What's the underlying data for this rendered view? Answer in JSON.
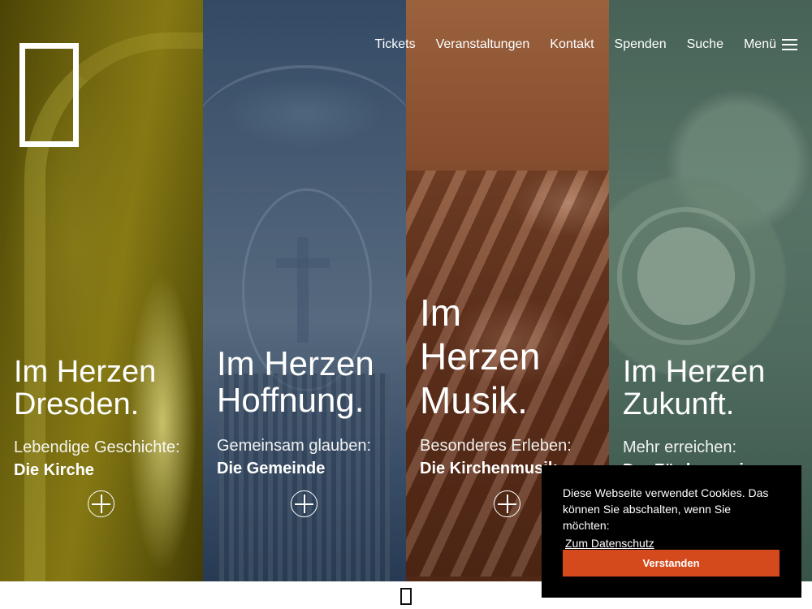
{
  "nav": {
    "items": [
      "Tickets",
      "Veranstaltungen",
      "Kontakt",
      "Spenden",
      "Suche"
    ],
    "menu_label": "Menü"
  },
  "panels": [
    {
      "headline": "Im Herzen Dresden.",
      "subtitle": "Lebendige Geschichte:",
      "link": "Die Kirche",
      "tint": "#8c801c"
    },
    {
      "headline": "Im Herzen Hoffnung.",
      "subtitle": "Gemeinsam glauben:",
      "link": "Die Gemeinde",
      "tint": "#58687a"
    },
    {
      "headline": "Im Herzen Musik.",
      "subtitle": "Besonderes Erleben:",
      "link": "Die Kirchenmusik",
      "tint": "#7c4e35"
    },
    {
      "headline": "Im Herzen Zukunft.",
      "subtitle": "Mehr erreichen:",
      "link": "Der Förderverein",
      "tint": "#637a6c"
    }
  ],
  "cookie_banner": {
    "message": "Diese Webseite verwendet Cookies. Das können Sie abschalten, wenn Sie möchten:",
    "link": "Zum Datenschutz",
    "button": "Verstanden",
    "background": "#000000",
    "button_color": "#d54a1c"
  },
  "icons": {
    "logo": "logo-frame-icon",
    "menu": "hamburger-icon",
    "expand": "plus-circle-icon",
    "bottom": "rectangle-outline-icon"
  }
}
